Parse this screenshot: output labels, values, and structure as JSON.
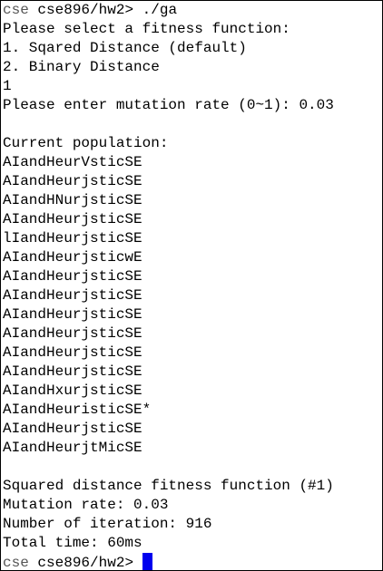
{
  "terminal": {
    "prompt_host": "cse",
    "prompt_path": "cse896/hw2>",
    "command": "./ga",
    "menu_title": "Please select a fitness function:",
    "option_1": "1. Sqared Distance (default)",
    "option_2": "2. Binary Distance",
    "choice": "1",
    "mutation_prompt": "Please enter mutation rate (0~1): 0.03",
    "population_header": "Current population:",
    "population": [
      "AIandHeurVsticSE",
      "AIandHeurjsticSE",
      "AIandHNurjsticSE",
      "AIandHeurjsticSE",
      "lIandHeurjsticSE",
      "AIandHeurjsticwE",
      "AIandHeurjsticSE",
      "AIandHeurjsticSE",
      "AIandHeurjsticSE",
      "AIandHeurjsticSE",
      "AIandHeurjsticSE",
      "AIandHeurjsticSE",
      "AIandHxurjsticSE",
      "AIandHeuristicSE*",
      "AIandHeurjsticSE",
      "AIandHeurjtMicSE"
    ],
    "summary": {
      "fitness": "Squared distance fitness function (#1)",
      "mutation": "Mutation rate: 0.03",
      "iterations": "Number of iteration: 916",
      "time": "Total time: 60ms"
    },
    "cursor_color": "#0000ee"
  }
}
